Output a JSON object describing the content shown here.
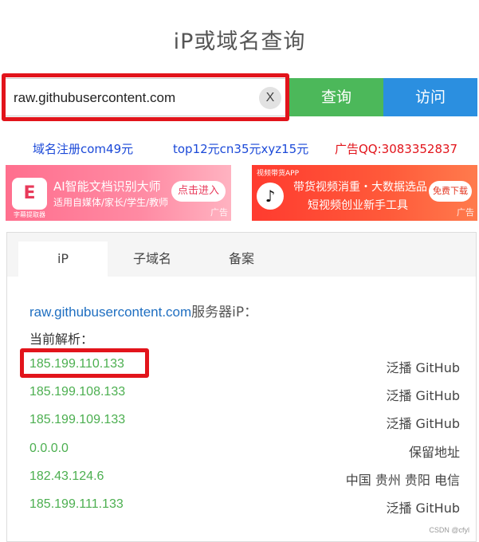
{
  "page": {
    "title": "iP或域名查询"
  },
  "search": {
    "value": "raw.githubusercontent.com",
    "clear_label": "X",
    "query_label": "查询",
    "visit_label": "访问"
  },
  "ad_links": [
    {
      "text": "域名注册com49元"
    },
    {
      "text": "top12元cn35元xyz15元"
    },
    {
      "text": "广告QQ:3083352837"
    }
  ],
  "banners": {
    "left": {
      "logo": "E",
      "logo_caption": "字幕提取器",
      "title": "AI智能文档识别大师",
      "subtitle": "适用自媒体/家长/学生/教师",
      "button": "点击进入",
      "tag": "广告"
    },
    "right": {
      "small": "视频带货APP",
      "logo": "♪",
      "title": "带货视频消重・大数据选品",
      "subtitle": "短视频创业新手工具",
      "button": "免费下载",
      "tag": "广告"
    }
  },
  "tabs": [
    {
      "label": "iP",
      "active": true
    },
    {
      "label": "子域名",
      "active": false
    },
    {
      "label": "备案",
      "active": false
    }
  ],
  "result": {
    "host": "raw.githubusercontent.com",
    "host_suffix": "服务器iP：",
    "current_label": "当前解析：",
    "rows": [
      {
        "ip": "185.199.110.133",
        "location": "泛播 GitHub"
      },
      {
        "ip": "185.199.108.133",
        "location": "泛播 GitHub"
      },
      {
        "ip": "185.199.109.133",
        "location": "泛播 GitHub"
      },
      {
        "ip": "0.0.0.0",
        "location": "保留地址"
      },
      {
        "ip": "182.43.124.6",
        "location": "中国 贵州 贵阳 电信"
      },
      {
        "ip": "185.199.111.133",
        "location": "泛播 GitHub"
      }
    ]
  },
  "watermark": "CSDN @cfyl",
  "colors": {
    "query_button": "#4cb85a",
    "visit_button": "#2b8fe0",
    "highlight": "#e2141b",
    "ip_text": "#4caf50",
    "link_blue": "#1b49d8"
  }
}
